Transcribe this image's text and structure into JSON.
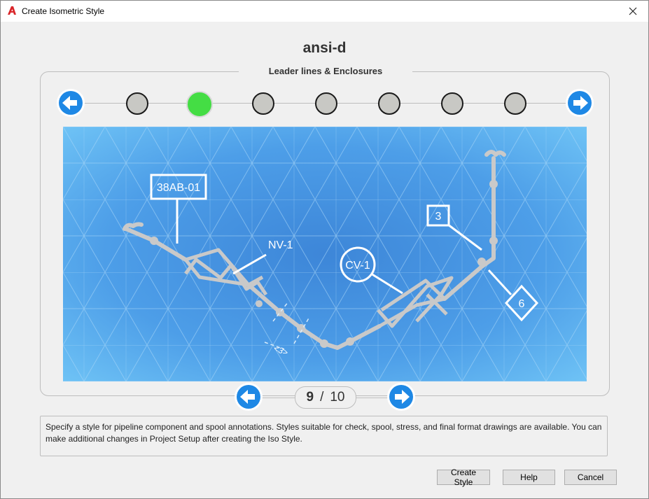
{
  "window": {
    "title": "Create Isometric Style"
  },
  "style_name": "ansi-d",
  "wizard": {
    "step_title": "Leader lines & Enclosures",
    "steps_count": 8,
    "active_step_index": 2
  },
  "preview": {
    "labels": {
      "tag_line": "38AB-01",
      "valve_nv": "NV-1",
      "valve_cv": "CV-1",
      "square_tag": "3",
      "diamond_tag": "6",
      "dimension": "<3>"
    }
  },
  "pager": {
    "current": "9",
    "separator": "/",
    "total": "10"
  },
  "description": "Specify a style for pipeline component and spool annotations. Styles suitable for check, spool, stress, and final format drawings are available. You can make additional changes in Project Setup after creating the Iso Style.",
  "buttons": {
    "create": "Create Style",
    "help": "Help",
    "cancel": "Cancel"
  },
  "colors": {
    "active_step": "#44dd44",
    "inactive_step": "#c8c8c4",
    "nav_arrow": "#1e88e5",
    "preview_bg": "#4a9ee6"
  }
}
